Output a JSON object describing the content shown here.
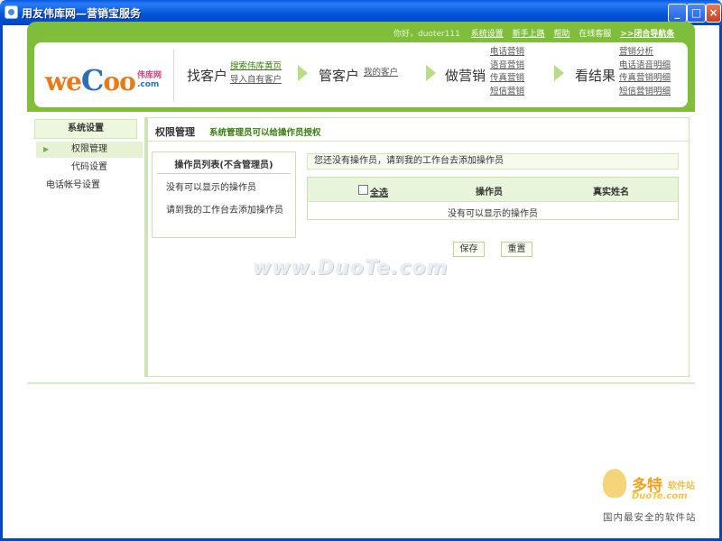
{
  "window": {
    "title": "用友伟库网—营销宝服务",
    "minimize": "_",
    "maximize": "□",
    "close": "×"
  },
  "topnav": {
    "greeting": "你好，duoter111",
    "links": [
      "系统设置",
      "新手上路",
      "帮助",
      "在线客服",
      ">>闭合导航条"
    ]
  },
  "logo": {
    "text_part1": "we",
    "text_c": "C",
    "text_part2": "oo",
    "sub1": "伟库网",
    "sub2": ".com"
  },
  "steps": [
    {
      "label": "找客户",
      "links": [
        "搜索伟库黄页",
        "导入自有客户"
      ]
    },
    {
      "label": "管客户",
      "links": [
        "我的客户"
      ]
    },
    {
      "label": "做营销",
      "links": [
        "电话营销",
        "语音营销",
        "传真营销",
        "短信营销"
      ]
    },
    {
      "label": "看结果",
      "links": [
        "营销分析",
        "电话语音明细",
        "传真营销明细",
        "短信营销明细"
      ]
    }
  ],
  "sidebar": {
    "title": "系统设置",
    "items": [
      "权限管理",
      "代码设置",
      "电话帐号设置"
    ]
  },
  "main": {
    "title": "权限管理",
    "hint": "系统管理员可以给操作员授权",
    "op_panel": {
      "heading": "操作员列表(不含管理员)",
      "empty": "没有可以显示的操作员",
      "add_hint": "请到我的工作台去添加操作员"
    },
    "notice": "您还没有操作员，请到我的工作台去添加操作员",
    "table": {
      "select_all": "全选",
      "col_operator": "操作员",
      "col_realname": "真实姓名",
      "empty": "没有可以显示的操作员"
    },
    "buttons": {
      "save": "保存",
      "reset": "重置"
    }
  },
  "watermark": "www.DuoTe.com",
  "badge": {
    "name": "多特",
    "name_small": "软件站",
    "domain": "DuoTe.com",
    "slogan": "国内最安全的软件站"
  }
}
